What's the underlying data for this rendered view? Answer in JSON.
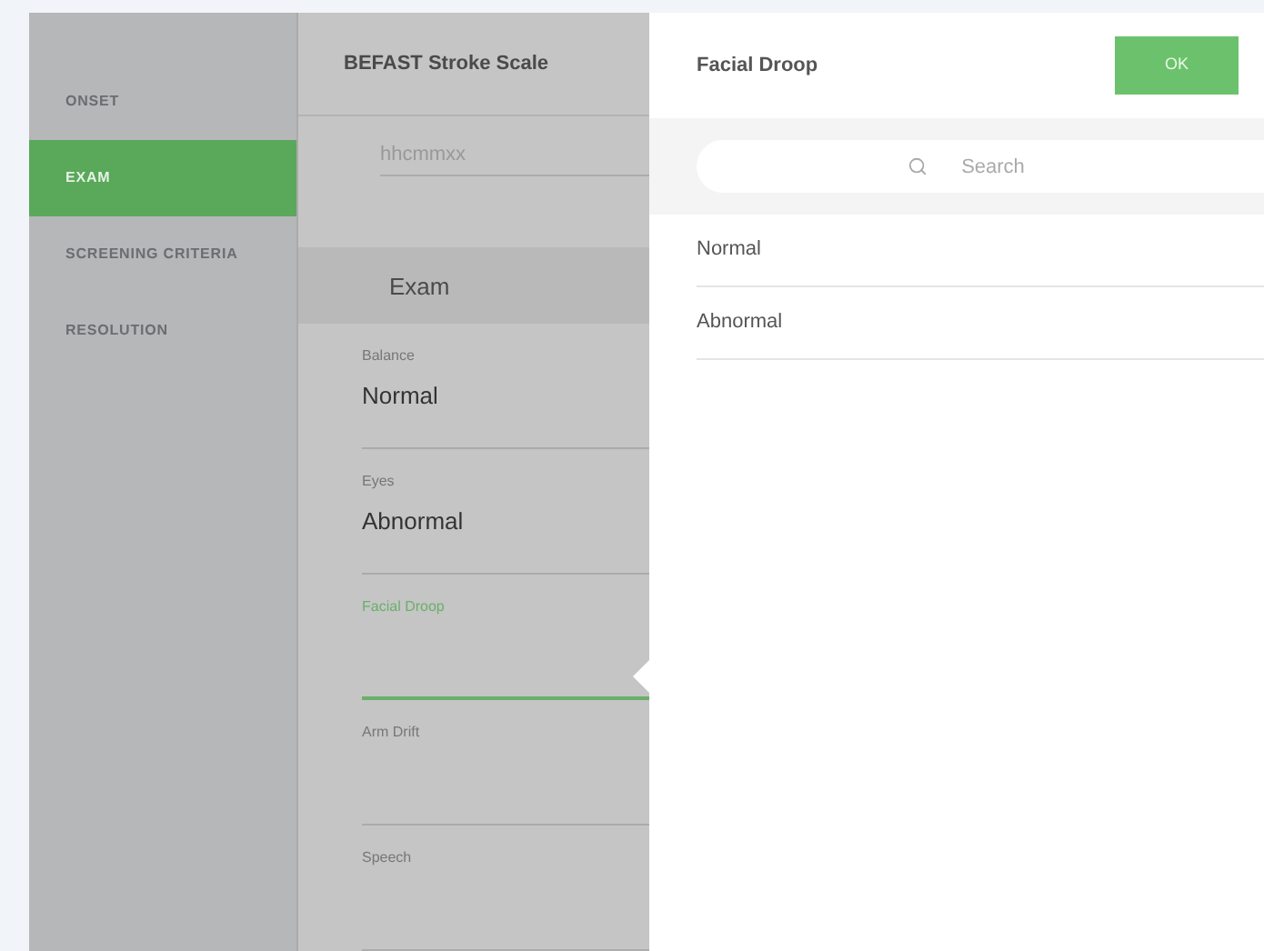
{
  "sidebar": {
    "items": [
      {
        "label": "ONSET",
        "selected": false
      },
      {
        "label": "EXAM",
        "selected": true
      },
      {
        "label": "SCREENING CRITERIA",
        "selected": false
      },
      {
        "label": "RESOLUTION",
        "selected": false
      }
    ]
  },
  "form": {
    "title": "BEFAST Stroke Scale",
    "top_field": "hhcmmxx",
    "section": "Exam",
    "fields": [
      {
        "label": "Balance",
        "value": "Normal",
        "selected": false
      },
      {
        "label": "Eyes",
        "value": "Abnormal",
        "selected": false
      },
      {
        "label": "Facial Droop",
        "selected": true
      },
      {
        "label": "Arm Drift",
        "selected": false
      },
      {
        "label": "Speech",
        "selected": false
      }
    ]
  },
  "picker": {
    "title": "Facial Droop",
    "ok": "OK",
    "search": {
      "placeholder": "Search"
    },
    "options": [
      "Normal",
      "Abnormal"
    ]
  }
}
